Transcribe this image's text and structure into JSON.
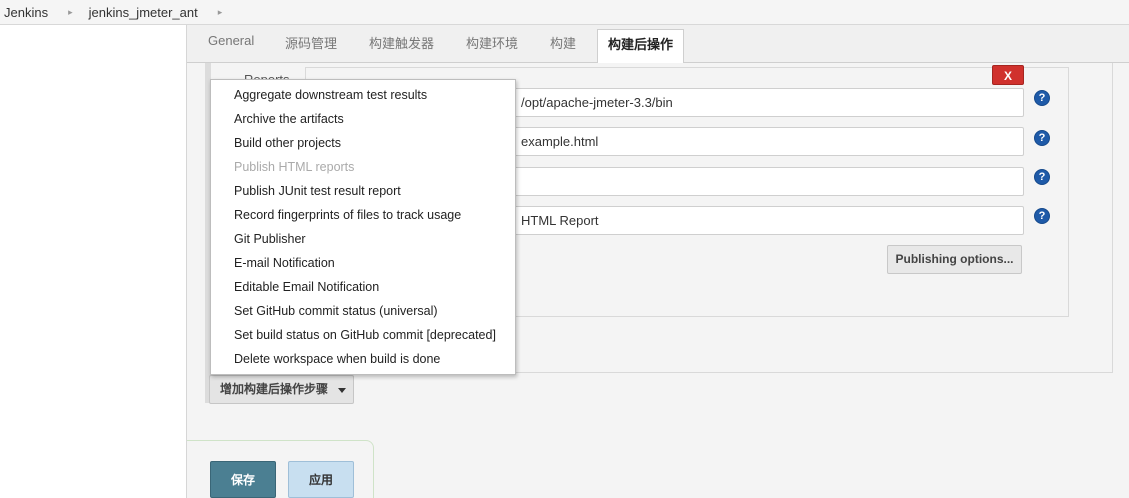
{
  "breadcrumb": {
    "items": [
      "Jenkins",
      "jenkins_jmeter_ant"
    ],
    "separator": "▸"
  },
  "tabs": [
    {
      "label": "General"
    },
    {
      "label": "源码管理"
    },
    {
      "label": "构建触发器"
    },
    {
      "label": "构建环境"
    },
    {
      "label": "构建"
    },
    {
      "label": "构建后操作"
    }
  ],
  "section": {
    "reports_label": "Reports",
    "delete_label": "X",
    "fields": [
      {
        "value": "/opt/apache-jmeter-3.3/bin"
      },
      {
        "value": "example.html"
      },
      {
        "value": ""
      },
      {
        "value": "HTML Report"
      }
    ],
    "help_icon_glyph": "?",
    "publishing_options_label": "Publishing options..."
  },
  "menu": {
    "items": [
      {
        "label": "Aggregate downstream test results",
        "disabled": false
      },
      {
        "label": "Archive the artifacts",
        "disabled": false
      },
      {
        "label": "Build other projects",
        "disabled": false
      },
      {
        "label": "Publish HTML reports",
        "disabled": true
      },
      {
        "label": "Publish JUnit test result report",
        "disabled": false
      },
      {
        "label": "Record fingerprints of files to track usage",
        "disabled": false
      },
      {
        "label": "Git Publisher",
        "disabled": false
      },
      {
        "label": "E-mail Notification",
        "disabled": false
      },
      {
        "label": "Editable Email Notification",
        "disabled": false
      },
      {
        "label": "Set GitHub commit status (universal)",
        "disabled": false
      },
      {
        "label": "Set build status on GitHub commit [deprecated]",
        "disabled": false
      },
      {
        "label": "Delete workspace when build is done",
        "disabled": false
      }
    ]
  },
  "add_step_button": "增加构建后操作步骤",
  "footer": {
    "save_label": "保存",
    "apply_label": "应用"
  },
  "colors": {
    "delete_red": "#d0312d",
    "help_blue": "#1e5aa8",
    "save_teal": "#4b7f92",
    "apply_light_blue": "#c8dff0"
  }
}
